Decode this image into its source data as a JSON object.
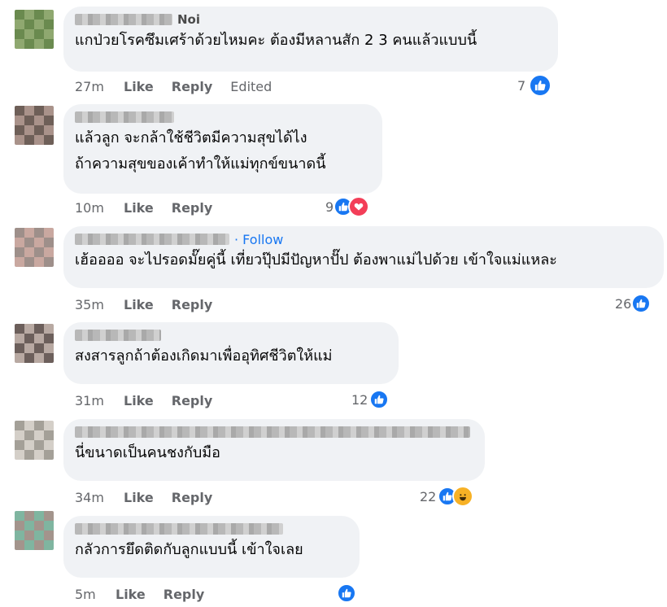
{
  "comments": [
    {
      "name": "Noi",
      "lines": [
        "แกป่วยโรคซึมเศร้าด้วยไหมคะ ต้องมีหลานสัก 2 3 คนแล้วแบบนี้"
      ],
      "time": "27m",
      "like": "Like",
      "reply": "Reply",
      "edited": "Edited",
      "reaction_count": "7"
    },
    {
      "name": "",
      "lines": [
        "แล้วลูก จะกล้าใช้ชีวิตมีความสุขได้ไง",
        "ถ้าความสุขของเค้าทำให้แม่ทุกข์ขนาดนี้"
      ],
      "time": "10m",
      "like": "Like",
      "reply": "Reply",
      "reaction_count": "9"
    },
    {
      "name": "",
      "follow": "· Follow",
      "lines": [
        "เฮ้ออออ จะไปรอดมั๊ยคู่นี้ เที่ยวปุ๊ปมีปัญหาปั๊ป ต้องพาแม่ไปด้วย เข้าใจแม่แหละ"
      ],
      "time": "35m",
      "like": "Like",
      "reply": "Reply",
      "reaction_count": "26"
    },
    {
      "name": "",
      "lines": [
        "สงสารลูกถ้าต้องเกิดมาเพื่ออุทิศชีวิตให้แม่"
      ],
      "time": "31m",
      "like": "Like",
      "reply": "Reply",
      "reaction_count": "12"
    },
    {
      "name": "",
      "lines": [
        "นี่ขนาดเป็นคนชงกับมือ"
      ],
      "time": "34m",
      "like": "Like",
      "reply": "Reply",
      "reaction_count": "22"
    },
    {
      "name": "",
      "lines": [
        "กลัวการยึดติดกับลูกแบบนี้ เข้าใจเลย"
      ],
      "time": "5m",
      "like": "Like",
      "reply": "Reply",
      "reaction_count": ""
    }
  ],
  "colors": {
    "accent": "#1877f2",
    "bubble": "#f0f2f5",
    "meta": "#65676b",
    "heart": "#f33e58",
    "haha": "#f7b125"
  },
  "icons": [
    "like-reaction-icon",
    "love-reaction-icon",
    "haha-reaction-icon"
  ]
}
